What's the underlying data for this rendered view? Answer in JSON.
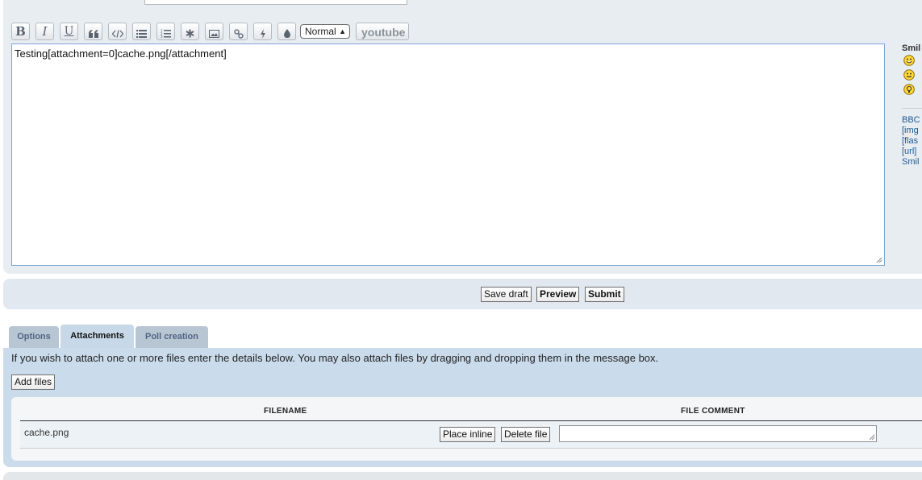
{
  "toolbar": {
    "bold_label": "B",
    "italic_label": "I",
    "underline_label": "U",
    "font_size": "Normal",
    "youtube_label": "youtube"
  },
  "editor": {
    "text": "Testing[attachment=0]cache.png[/attachment]"
  },
  "smilies": {
    "title": "Smil",
    "items": [
      "smile",
      "grin",
      "idea"
    ]
  },
  "bbcode_info": {
    "lines": [
      "BBC",
      "[img",
      "[flas",
      "[url]",
      "Smil"
    ]
  },
  "submit": {
    "save_draft": "Save draft",
    "preview": "Preview",
    "submit": "Submit"
  },
  "tabs": {
    "options": "Options",
    "attachments": "Attachments",
    "poll": "Poll creation"
  },
  "attachments": {
    "help_text": "If you wish to attach one or more files enter the details below. You may also attach files by dragging and dropping them in the message box.",
    "add_files": "Add files",
    "col_filename": "FILENAME",
    "col_comment": "FILE COMMENT",
    "files": [
      {
        "name": "cache.png",
        "place_inline": "Place inline",
        "delete": "Delete file",
        "comment": ""
      }
    ]
  }
}
